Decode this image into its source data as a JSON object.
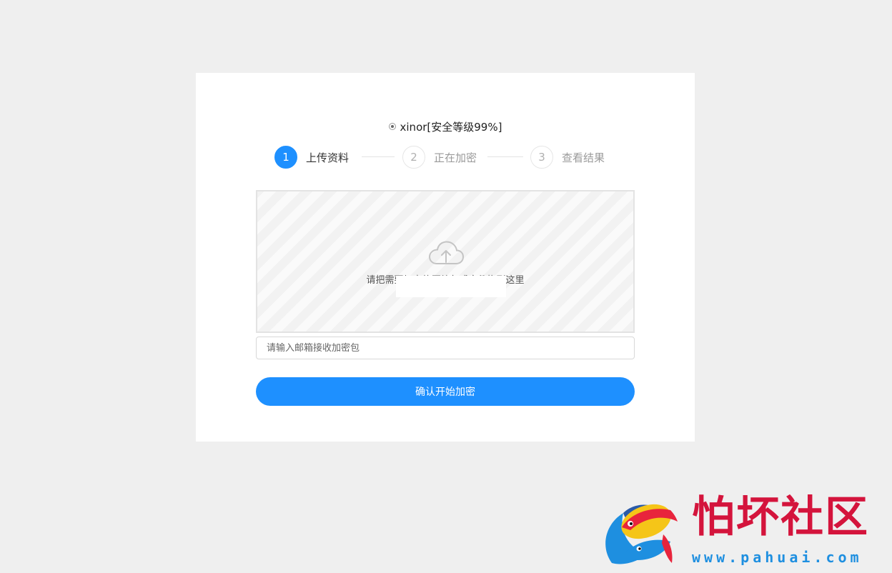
{
  "algorithm": {
    "label": "xinor[安全等级99%]",
    "selected": true
  },
  "steps": [
    {
      "number": "1",
      "label": "上传资料",
      "active": true
    },
    {
      "number": "2",
      "label": "正在加密",
      "active": false
    },
    {
      "number": "3",
      "label": "查看结果",
      "active": false
    }
  ],
  "dropzone": {
    "icon": "cloud-upload-icon",
    "text": "请把需要加密的压缩包或文件拖到这里"
  },
  "email": {
    "placeholder": "请输入邮箱接收加密包",
    "value": ""
  },
  "confirm_button": {
    "label": "确认开始加密"
  },
  "watermark": {
    "title": "怕坏社区",
    "url": "www.pahuai.com"
  },
  "colors": {
    "accent": "#1e90ff",
    "background": "#efefef",
    "card": "#ffffff",
    "watermark_title": "#d4143c",
    "watermark_url": "#1e8fe0"
  }
}
